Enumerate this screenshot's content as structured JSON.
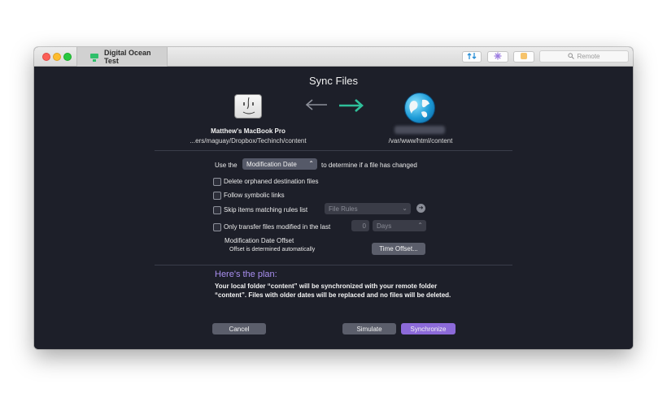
{
  "window": {
    "tab_title": "Digital Ocean Test",
    "search_placeholder": "Remote"
  },
  "sync": {
    "title": "Sync Files",
    "source": {
      "name": "Matthew's MacBook Pro",
      "path": "...ers/maguay/Dropbox/Techinch/content"
    },
    "destination": {
      "name": "",
      "path": "/var/www/html/content"
    }
  },
  "options": {
    "use_the_prefix": "Use the",
    "compare_method": "Modification Date",
    "use_the_suffix": "to determine if a file has changed",
    "delete_orphaned": "Delete orphaned destination files",
    "follow_symlinks": "Follow symbolic links",
    "skip_items": "Skip items matching rules list",
    "file_rules_placeholder": "File Rules",
    "only_transfer": "Only transfer files modified in the last",
    "days_value": "0",
    "days_unit": "Days",
    "offset_title": "Modification Date Offset",
    "offset_desc": "Offset is determined automatically",
    "time_offset_button": "Time Offset..."
  },
  "plan": {
    "heading": "Here's the plan:",
    "text": "Your local folder “content” will be synchronized with your remote folder “content”. Files with older dates will be replaced and no files will be deleted."
  },
  "buttons": {
    "cancel": "Cancel",
    "simulate": "Simulate",
    "synchronize": "Synchronize"
  },
  "colors": {
    "background": "#1d1f29",
    "accent": "#8c6ad9",
    "plan_heading": "#a98ff0",
    "arrow_active": "#2fbf9a"
  },
  "icons": {
    "finder": "finder-icon",
    "server": "globe-icon",
    "direction": "arrow-right-icon"
  }
}
